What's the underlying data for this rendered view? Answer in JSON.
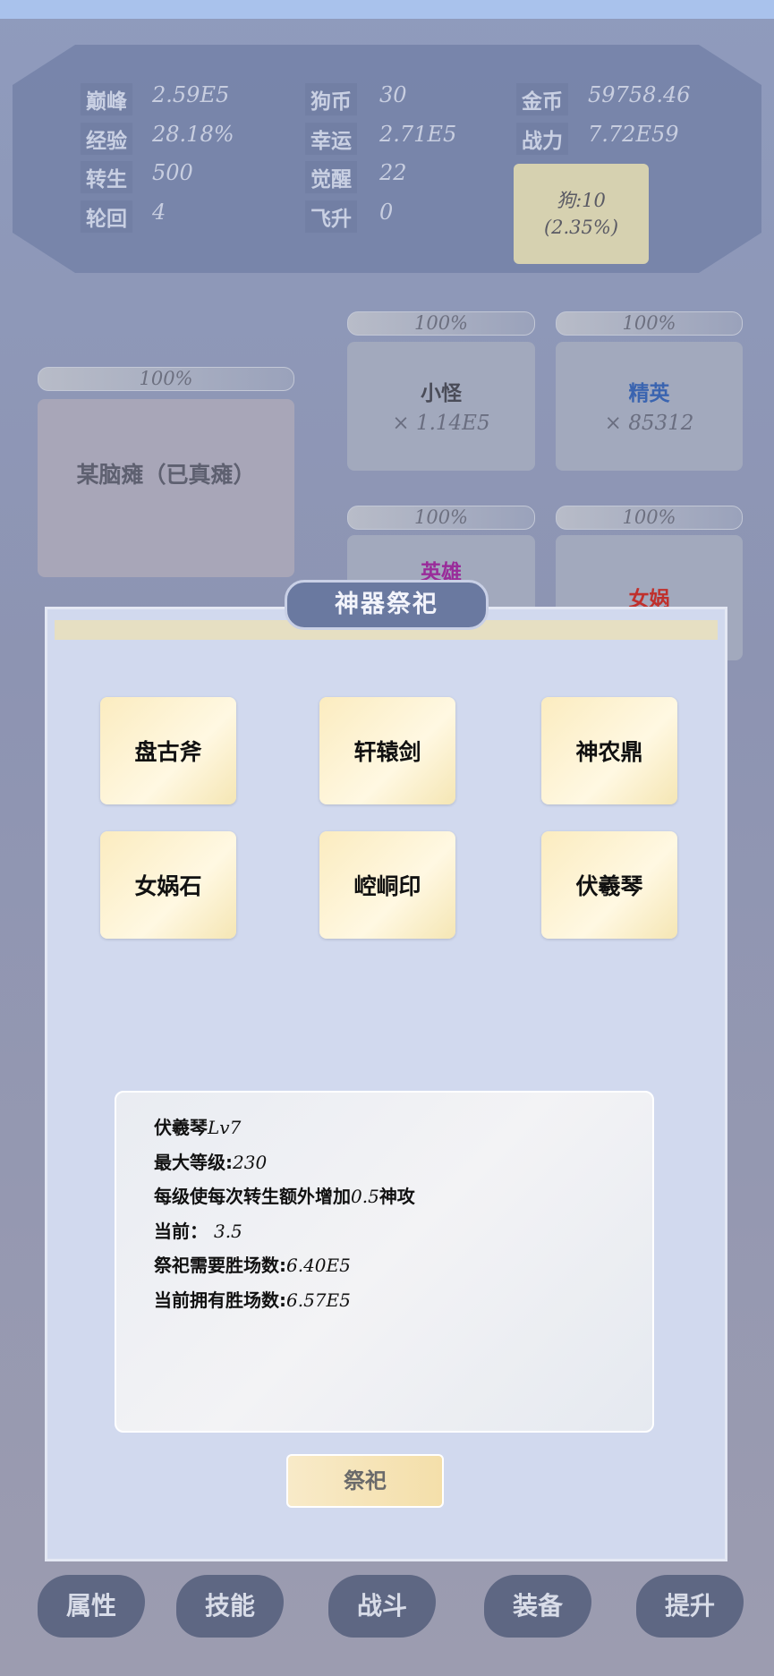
{
  "stats": [
    {
      "label": "巅峰",
      "value": "2.59E5"
    },
    {
      "label": "狗币",
      "value": "30"
    },
    {
      "label": "金币",
      "value": "59758.46"
    },
    {
      "label": "经验",
      "value": "28.18%"
    },
    {
      "label": "幸运",
      "value": "2.71E5"
    },
    {
      "label": "战力",
      "value": "7.72E59"
    },
    {
      "label": "转生",
      "value": "500"
    },
    {
      "label": "觉醒",
      "value": "22"
    },
    {
      "label": "轮回",
      "value": "4"
    },
    {
      "label": "飞升",
      "value": "0"
    }
  ],
  "dog_button": {
    "line1": "狗:10",
    "line2": "(2.35%)"
  },
  "enemies": {
    "boss": {
      "hp": "100%",
      "name": "某脑瘫（已真瘫）"
    },
    "minion": {
      "hp": "100%",
      "name": "小怪",
      "count": "× 1.14E5"
    },
    "elite": {
      "hp": "100%",
      "name": "精英",
      "count": "× 85312",
      "color": "#3a64b0"
    },
    "slot3": {
      "hp": "100%",
      "name": "英雄"
    },
    "slot4": {
      "hp": "100%",
      "name": "女娲",
      "color": "#c0302c"
    }
  },
  "modal": {
    "title": "神器祭祀",
    "artifacts": [
      "盘古斧",
      "轩辕剑",
      "神农鼎",
      "女娲石",
      "崆峒印",
      "伏羲琴"
    ],
    "selected": "伏羲琴",
    "info": {
      "name": "伏羲琴",
      "level": "Lv7",
      "max_label": "最大等级:",
      "max_value": "230",
      "desc_a": "每级使每次转生额外增加",
      "desc_num": "0.5",
      "desc_b": "神攻",
      "cur_label": "当前：",
      "cur_value": "3.5",
      "need_label": "祭祀需要胜场数:",
      "need_value": "6.40E5",
      "have_label": "当前拥有胜场数:",
      "have_value": "6.57E5"
    },
    "action": "祭祀"
  },
  "nav": [
    "属性",
    "技能",
    "战斗",
    "装备",
    "提升"
  ]
}
